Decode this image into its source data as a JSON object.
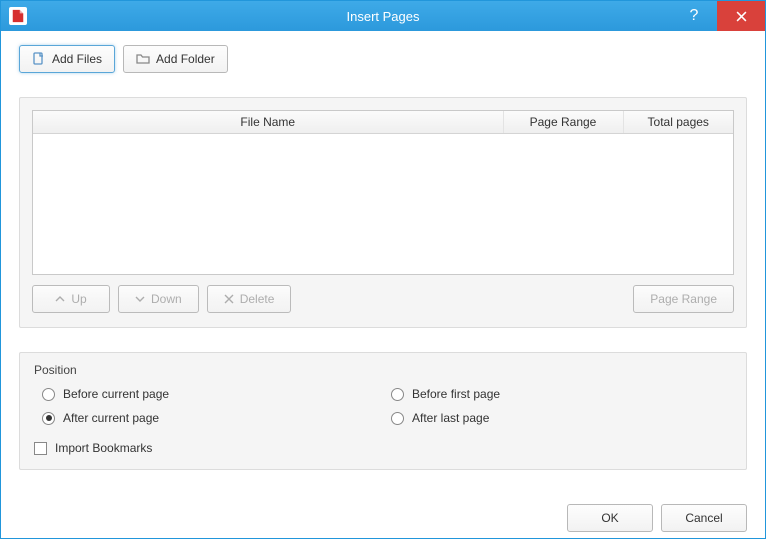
{
  "window": {
    "title": "Insert Pages"
  },
  "toolbar": {
    "add_files": "Add Files",
    "add_folder": "Add Folder"
  },
  "table": {
    "headers": {
      "filename": "File Name",
      "page_range": "Page Range",
      "total_pages": "Total pages"
    },
    "rows": []
  },
  "list_buttons": {
    "up": "Up",
    "down": "Down",
    "delete": "Delete",
    "page_range": "Page Range"
  },
  "position": {
    "group_label": "Position",
    "before_current": "Before current page",
    "after_current": "After current page",
    "before_first": "Before first page",
    "after_last": "After last page",
    "selected": "after_current"
  },
  "import_bookmarks": {
    "label": "Import Bookmarks",
    "checked": false
  },
  "footer": {
    "ok": "OK",
    "cancel": "Cancel"
  }
}
